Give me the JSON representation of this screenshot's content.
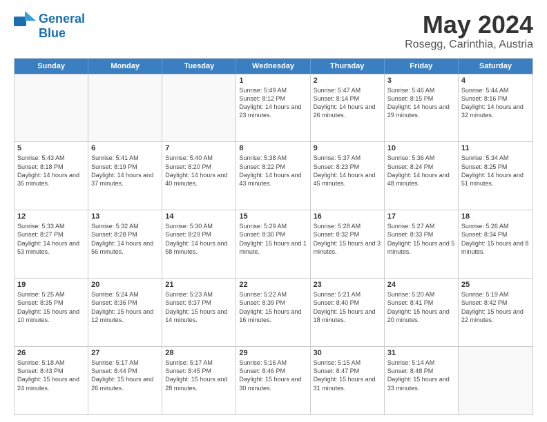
{
  "header": {
    "logo_general": "General",
    "logo_blue": "Blue",
    "main_title": "May 2024",
    "subtitle": "Rosegg, Carinthia, Austria"
  },
  "days_of_week": [
    "Sunday",
    "Monday",
    "Tuesday",
    "Wednesday",
    "Thursday",
    "Friday",
    "Saturday"
  ],
  "weeks": [
    [
      {
        "day": "",
        "sunrise": "",
        "sunset": "",
        "daylight": ""
      },
      {
        "day": "",
        "sunrise": "",
        "sunset": "",
        "daylight": ""
      },
      {
        "day": "",
        "sunrise": "",
        "sunset": "",
        "daylight": ""
      },
      {
        "day": "1",
        "sunrise": "Sunrise: 5:49 AM",
        "sunset": "Sunset: 8:12 PM",
        "daylight": "Daylight: 14 hours and 23 minutes."
      },
      {
        "day": "2",
        "sunrise": "Sunrise: 5:47 AM",
        "sunset": "Sunset: 8:14 PM",
        "daylight": "Daylight: 14 hours and 26 minutes."
      },
      {
        "day": "3",
        "sunrise": "Sunrise: 5:46 AM",
        "sunset": "Sunset: 8:15 PM",
        "daylight": "Daylight: 14 hours and 29 minutes."
      },
      {
        "day": "4",
        "sunrise": "Sunrise: 5:44 AM",
        "sunset": "Sunset: 8:16 PM",
        "daylight": "Daylight: 14 hours and 32 minutes."
      }
    ],
    [
      {
        "day": "5",
        "sunrise": "Sunrise: 5:43 AM",
        "sunset": "Sunset: 8:18 PM",
        "daylight": "Daylight: 14 hours and 35 minutes."
      },
      {
        "day": "6",
        "sunrise": "Sunrise: 5:41 AM",
        "sunset": "Sunset: 8:19 PM",
        "daylight": "Daylight: 14 hours and 37 minutes."
      },
      {
        "day": "7",
        "sunrise": "Sunrise: 5:40 AM",
        "sunset": "Sunset: 8:20 PM",
        "daylight": "Daylight: 14 hours and 40 minutes."
      },
      {
        "day": "8",
        "sunrise": "Sunrise: 5:38 AM",
        "sunset": "Sunset: 8:22 PM",
        "daylight": "Daylight: 14 hours and 43 minutes."
      },
      {
        "day": "9",
        "sunrise": "Sunrise: 5:37 AM",
        "sunset": "Sunset: 8:23 PM",
        "daylight": "Daylight: 14 hours and 45 minutes."
      },
      {
        "day": "10",
        "sunrise": "Sunrise: 5:36 AM",
        "sunset": "Sunset: 8:24 PM",
        "daylight": "Daylight: 14 hours and 48 minutes."
      },
      {
        "day": "11",
        "sunrise": "Sunrise: 5:34 AM",
        "sunset": "Sunset: 8:25 PM",
        "daylight": "Daylight: 14 hours and 51 minutes."
      }
    ],
    [
      {
        "day": "12",
        "sunrise": "Sunrise: 5:33 AM",
        "sunset": "Sunset: 8:27 PM",
        "daylight": "Daylight: 14 hours and 53 minutes."
      },
      {
        "day": "13",
        "sunrise": "Sunrise: 5:32 AM",
        "sunset": "Sunset: 8:28 PM",
        "daylight": "Daylight: 14 hours and 56 minutes."
      },
      {
        "day": "14",
        "sunrise": "Sunrise: 5:30 AM",
        "sunset": "Sunset: 8:29 PM",
        "daylight": "Daylight: 14 hours and 58 minutes."
      },
      {
        "day": "15",
        "sunrise": "Sunrise: 5:29 AM",
        "sunset": "Sunset: 8:30 PM",
        "daylight": "Daylight: 15 hours and 1 minute."
      },
      {
        "day": "16",
        "sunrise": "Sunrise: 5:28 AM",
        "sunset": "Sunset: 8:32 PM",
        "daylight": "Daylight: 15 hours and 3 minutes."
      },
      {
        "day": "17",
        "sunrise": "Sunrise: 5:27 AM",
        "sunset": "Sunset: 8:33 PM",
        "daylight": "Daylight: 15 hours and 5 minutes."
      },
      {
        "day": "18",
        "sunrise": "Sunrise: 5:26 AM",
        "sunset": "Sunset: 8:34 PM",
        "daylight": "Daylight: 15 hours and 8 minutes."
      }
    ],
    [
      {
        "day": "19",
        "sunrise": "Sunrise: 5:25 AM",
        "sunset": "Sunset: 8:35 PM",
        "daylight": "Daylight: 15 hours and 10 minutes."
      },
      {
        "day": "20",
        "sunrise": "Sunrise: 5:24 AM",
        "sunset": "Sunset: 8:36 PM",
        "daylight": "Daylight: 15 hours and 12 minutes."
      },
      {
        "day": "21",
        "sunrise": "Sunrise: 5:23 AM",
        "sunset": "Sunset: 8:37 PM",
        "daylight": "Daylight: 15 hours and 14 minutes."
      },
      {
        "day": "22",
        "sunrise": "Sunrise: 5:22 AM",
        "sunset": "Sunset: 8:39 PM",
        "daylight": "Daylight: 15 hours and 16 minutes."
      },
      {
        "day": "23",
        "sunrise": "Sunrise: 5:21 AM",
        "sunset": "Sunset: 8:40 PM",
        "daylight": "Daylight: 15 hours and 18 minutes."
      },
      {
        "day": "24",
        "sunrise": "Sunrise: 5:20 AM",
        "sunset": "Sunset: 8:41 PM",
        "daylight": "Daylight: 15 hours and 20 minutes."
      },
      {
        "day": "25",
        "sunrise": "Sunrise: 5:19 AM",
        "sunset": "Sunset: 8:42 PM",
        "daylight": "Daylight: 15 hours and 22 minutes."
      }
    ],
    [
      {
        "day": "26",
        "sunrise": "Sunrise: 5:18 AM",
        "sunset": "Sunset: 8:43 PM",
        "daylight": "Daylight: 15 hours and 24 minutes."
      },
      {
        "day": "27",
        "sunrise": "Sunrise: 5:17 AM",
        "sunset": "Sunset: 8:44 PM",
        "daylight": "Daylight: 15 hours and 26 minutes."
      },
      {
        "day": "28",
        "sunrise": "Sunrise: 5:17 AM",
        "sunset": "Sunset: 8:45 PM",
        "daylight": "Daylight: 15 hours and 28 minutes."
      },
      {
        "day": "29",
        "sunrise": "Sunrise: 5:16 AM",
        "sunset": "Sunset: 8:46 PM",
        "daylight": "Daylight: 15 hours and 30 minutes."
      },
      {
        "day": "30",
        "sunrise": "Sunrise: 5:15 AM",
        "sunset": "Sunset: 8:47 PM",
        "daylight": "Daylight: 15 hours and 31 minutes."
      },
      {
        "day": "31",
        "sunrise": "Sunrise: 5:14 AM",
        "sunset": "Sunset: 8:48 PM",
        "daylight": "Daylight: 15 hours and 33 minutes."
      },
      {
        "day": "",
        "sunrise": "",
        "sunset": "",
        "daylight": ""
      }
    ]
  ]
}
